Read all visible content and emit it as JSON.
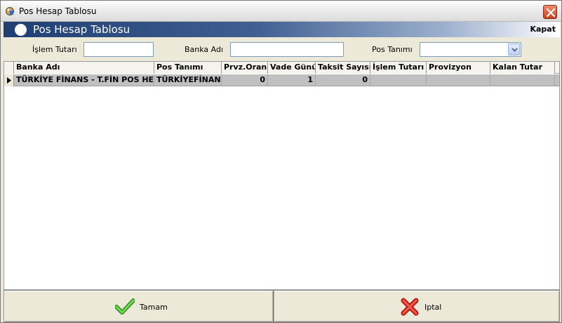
{
  "window": {
    "title": "Pos Hesap Tablosu"
  },
  "header": {
    "title": "Pos Hesap Tablosu",
    "close_label": "Kapat"
  },
  "filters": {
    "islem_tutari_label": "İşlem Tutarı",
    "islem_tutari_value": "",
    "banka_adi_label": "Banka Adı",
    "banka_adi_value": "",
    "pos_tanimi_label": "Pos Tanımı",
    "pos_tanimi_value": ""
  },
  "grid": {
    "columns": [
      "Banka Adı",
      "Pos Tanımı",
      "Prvz.Oranı",
      "Vade Günü",
      "Taksit Sayısı",
      "İşlem Tutarı",
      "Provizyon",
      "Kalan Tutar"
    ],
    "rows": [
      [
        "TÜRKİYE FİNANS - T.FİN POS HE",
        "TÜRKİYEFİNANS",
        "0",
        "1",
        "0",
        "",
        "",
        ""
      ]
    ]
  },
  "buttons": {
    "ok_label": "Tamam",
    "cancel_label": "Iptal"
  },
  "colors": {
    "header_blue": "#1f3f73",
    "selected_row": "#c0c0c0",
    "ok_green": "#3fae2a",
    "cancel_red": "#d2281f"
  }
}
